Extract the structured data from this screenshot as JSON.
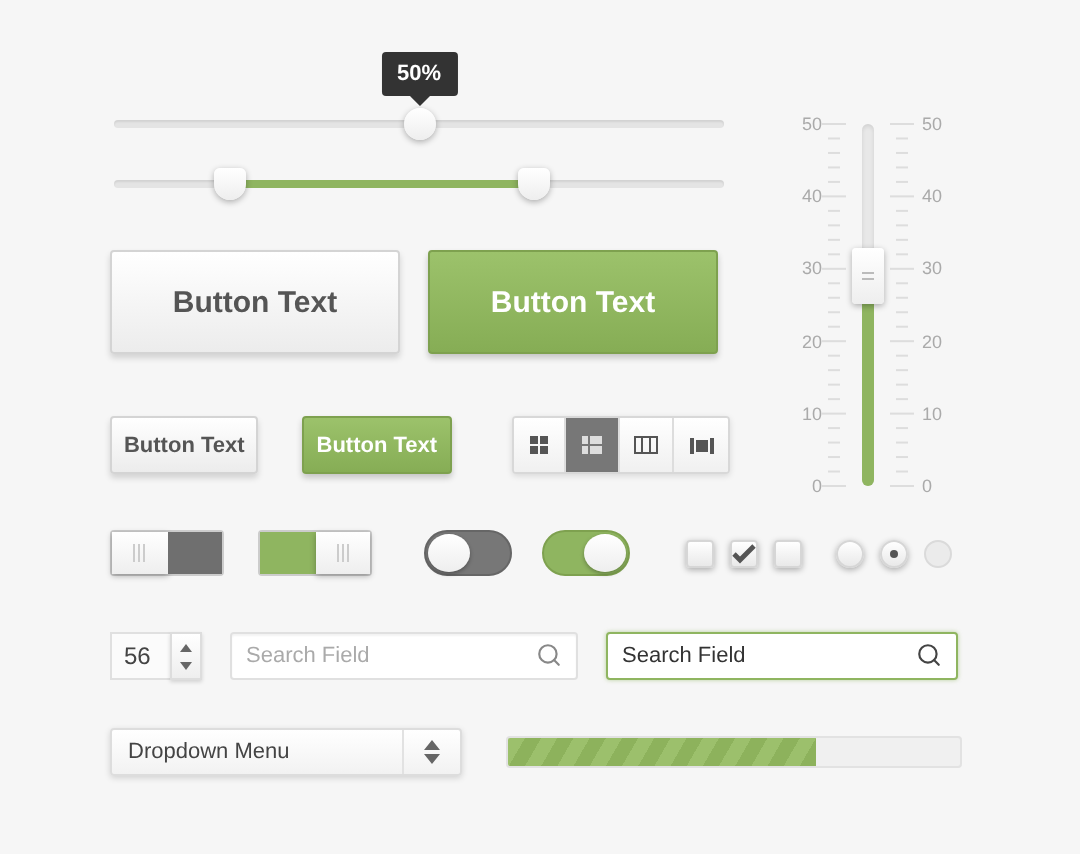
{
  "sliders": [
    {
      "kind": "single",
      "tooltip": "50%",
      "thumbs": [
        {
          "level": 0.5
        }
      ]
    },
    {
      "kind": "range",
      "thumbs": [
        {
          "level": 0.19
        },
        {
          "level": 0.69
        }
      ]
    }
  ],
  "vertical_slider": {
    "level": 0.58,
    "left_labels": [
      "50",
      "40",
      "30",
      "20",
      "10",
      "0"
    ],
    "right_labels": [
      "50",
      "40",
      "30",
      "20",
      "10",
      "0"
    ]
  },
  "large_buttons": [
    {
      "label": "Button Text",
      "kind": "default"
    },
    {
      "label": "Button Text",
      "kind": "primary"
    }
  ],
  "small_buttons": [
    {
      "label": "Button Text",
      "kind": "default"
    },
    {
      "label": "Button Text",
      "kind": "primary"
    }
  ],
  "view_switcher": [
    {
      "kind": "grid",
      "selected": false
    },
    {
      "kind": "list",
      "selected": true
    },
    {
      "kind": "columns",
      "selected": false
    },
    {
      "kind": "media",
      "selected": false
    }
  ],
  "toggles": [
    {
      "kind": "rect",
      "on": false
    },
    {
      "kind": "rect",
      "on": true
    },
    {
      "kind": "round",
      "on": false
    },
    {
      "kind": "round",
      "on": true
    }
  ],
  "checkboxes": [
    {
      "checked": false
    },
    {
      "checked": true
    },
    {
      "checked": false
    }
  ],
  "radios": [
    {
      "selected": false,
      "disabled": false
    },
    {
      "selected": true,
      "disabled": false
    },
    {
      "selected": false,
      "disabled": true
    }
  ],
  "spinner": {
    "value": "56"
  },
  "search_fields": [
    {
      "placeholder": "Search Field",
      "focused": false
    },
    {
      "value": "Search Field",
      "focused": true
    }
  ],
  "dropdown": {
    "value": "Dropdown Menu"
  },
  "progress": {
    "level": 0.68
  }
}
